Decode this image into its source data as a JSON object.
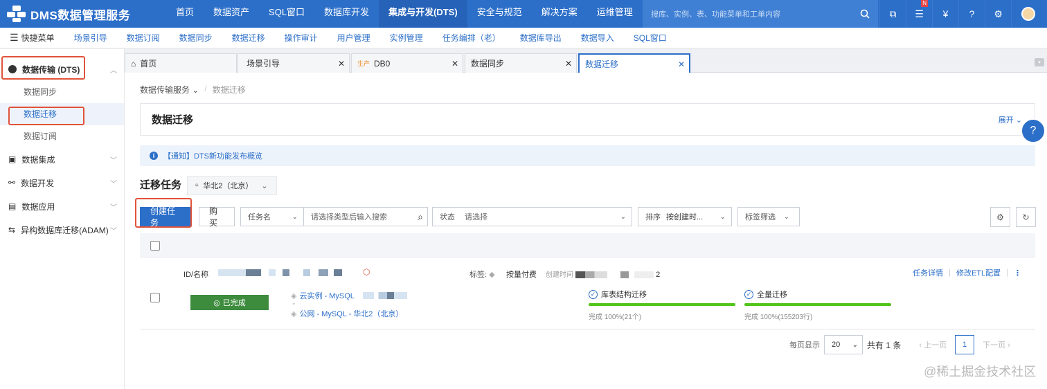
{
  "app": {
    "name": "DMS数据管理服务",
    "top_nav": [
      "首页",
      "数据资产",
      "SQL窗口",
      "数据库开发",
      "集成与开发(DTS)",
      "安全与规范",
      "解决方案",
      "运维管理"
    ],
    "active_nav_index": 4,
    "search_placeholder": "搜库、实例、表、功能菜单和工单内容",
    "notification_badge": "N"
  },
  "quickbar": {
    "menu_label": "快捷菜单",
    "items": [
      "场景引导",
      "数据订阅",
      "数据同步",
      "数据迁移",
      "操作审计",
      "用户管理",
      "实例管理",
      "任务编排（老）",
      "数据库导出",
      "数据导入",
      "SQL窗口"
    ]
  },
  "sidebar": {
    "groups": [
      {
        "label": "数据传输 (DTS)",
        "subitems": [
          "数据同步",
          "数据迁移",
          "数据订阅"
        ]
      },
      {
        "label": "数据集成"
      },
      {
        "label": "数据开发"
      },
      {
        "label": "数据应用"
      },
      {
        "label": "异构数据库迁移(ADAM)"
      }
    ]
  },
  "tabs": [
    {
      "label": "首页"
    },
    {
      "label": "场景引导"
    },
    {
      "label": "DB0",
      "env": "生产"
    },
    {
      "label": "数据同步"
    },
    {
      "label": "数据迁移"
    }
  ],
  "breadcrumb": {
    "parent": "数据传输服务",
    "current": "数据迁移"
  },
  "page": {
    "title": "数据迁移",
    "expand_label": "展开",
    "notice": "【通知】DTS新功能发布概览",
    "section_title": "迁移任务",
    "region": "华北2（北京）"
  },
  "toolbar": {
    "create_label": "创建任务",
    "buy_label": "购买",
    "task_name_select": "任务名",
    "search_placeholder": "请选择类型后输入搜索",
    "status_label": "状态",
    "status_placeholder": "请选择",
    "sort_label": "排序",
    "sort_value": "按创建时...",
    "tag_filter": "标签筛选"
  },
  "task": {
    "id_label": "ID/名称",
    "tags_label": "标签:",
    "pay_type": "按量付费",
    "create_time_label": "创建时间",
    "create_time_suffix": "2",
    "detail_link": "任务详情",
    "etl_link": "修改ETL配置",
    "status": "已完成",
    "source": "云实例 - MySQL",
    "destination": "公网 - MySQL - 华北2（北京）",
    "stages": [
      {
        "name": "库表结构迁移",
        "progress": 100,
        "summary": "完成 100%(21个)"
      },
      {
        "name": "全量迁移",
        "progress": 100,
        "summary": "完成 100%(155203行)"
      }
    ]
  },
  "pagination": {
    "per_page_label": "每页显示",
    "per_page": "20",
    "total_text": "共有 1 条",
    "prev": "上一页",
    "current": "1",
    "next": "下一页"
  },
  "watermark": "@稀土掘金技术社区",
  "colors": {
    "brand": "#2c6fc9",
    "success": "#3d8b3d",
    "progress": "#52c41a",
    "highlight": "#e0533b"
  }
}
